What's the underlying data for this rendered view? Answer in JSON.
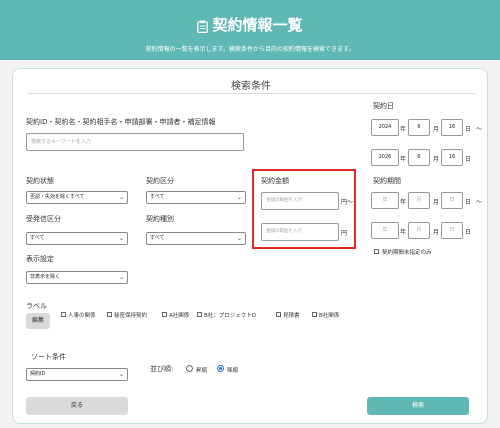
{
  "header": {
    "title": "契約情報一覧",
    "subtitle": "契約情報の一覧を表示します。検索条件から目的の契約情報を検索できます。"
  },
  "search": {
    "title": "検索条件",
    "keyword_label": "契約ID・契約名・契約相手名・申請部署・申請者・補足情報",
    "keyword_placeholder": "検索するキーワードを入力",
    "contract_date_label": "契約日",
    "date_from": {
      "year": "2024",
      "month": "6",
      "day": "16"
    },
    "date_to": {
      "year": "2026",
      "month": "6",
      "day": "16"
    },
    "year_unit": "年",
    "month_unit": "月",
    "day_unit": "日",
    "range_sep": "～",
    "status_label": "契約状態",
    "status_value": "否認・失効を除くすべて",
    "category_label": "契約区分",
    "category_value": "すべて",
    "amount_label": "契約金額",
    "amount_placeholder": "金額の範囲を入力",
    "yen_unit": "円",
    "period_label": "契約期間",
    "period_placeholders": {
      "year": "年",
      "month": "月",
      "day": "日"
    },
    "period_unspecified_label": "契約期間未指定のみ",
    "send_label": "受発信区分",
    "send_value": "すべて",
    "type_label": "契約種別",
    "type_value": "すべて",
    "display_label": "表示設定",
    "display_value": "非表示を除く",
    "label_label": "ラベル",
    "edit_button": "編集",
    "labels": [
      "人事の関係",
      "秘密保持契約",
      "A社関係",
      "B社：プロジェクトD",
      "見積書",
      "B社関係"
    ],
    "sort_label": "ソート条件",
    "sort_value": "契約ID",
    "order_label": "並び順:",
    "order_asc": "昇順",
    "order_desc": "降順",
    "back_button": "戻る",
    "search_button": "検索"
  },
  "colors": {
    "header": "#5fb8b4",
    "search_button": "#5fb8b4",
    "highlight": "#e12a23",
    "back_button": "#d9d9d9"
  }
}
